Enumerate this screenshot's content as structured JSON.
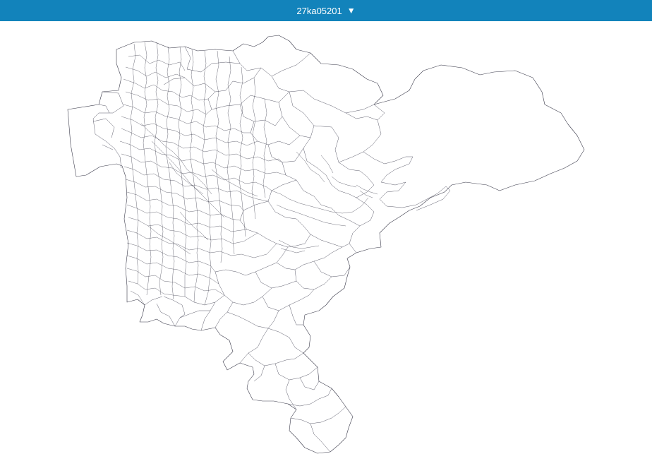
{
  "header": {
    "selector_label": "27ka05201",
    "caret": "▼",
    "color": "#1283bb"
  },
  "map": {
    "stroke_color": "#3a3a4a",
    "fill_color": "#ffffff"
  }
}
